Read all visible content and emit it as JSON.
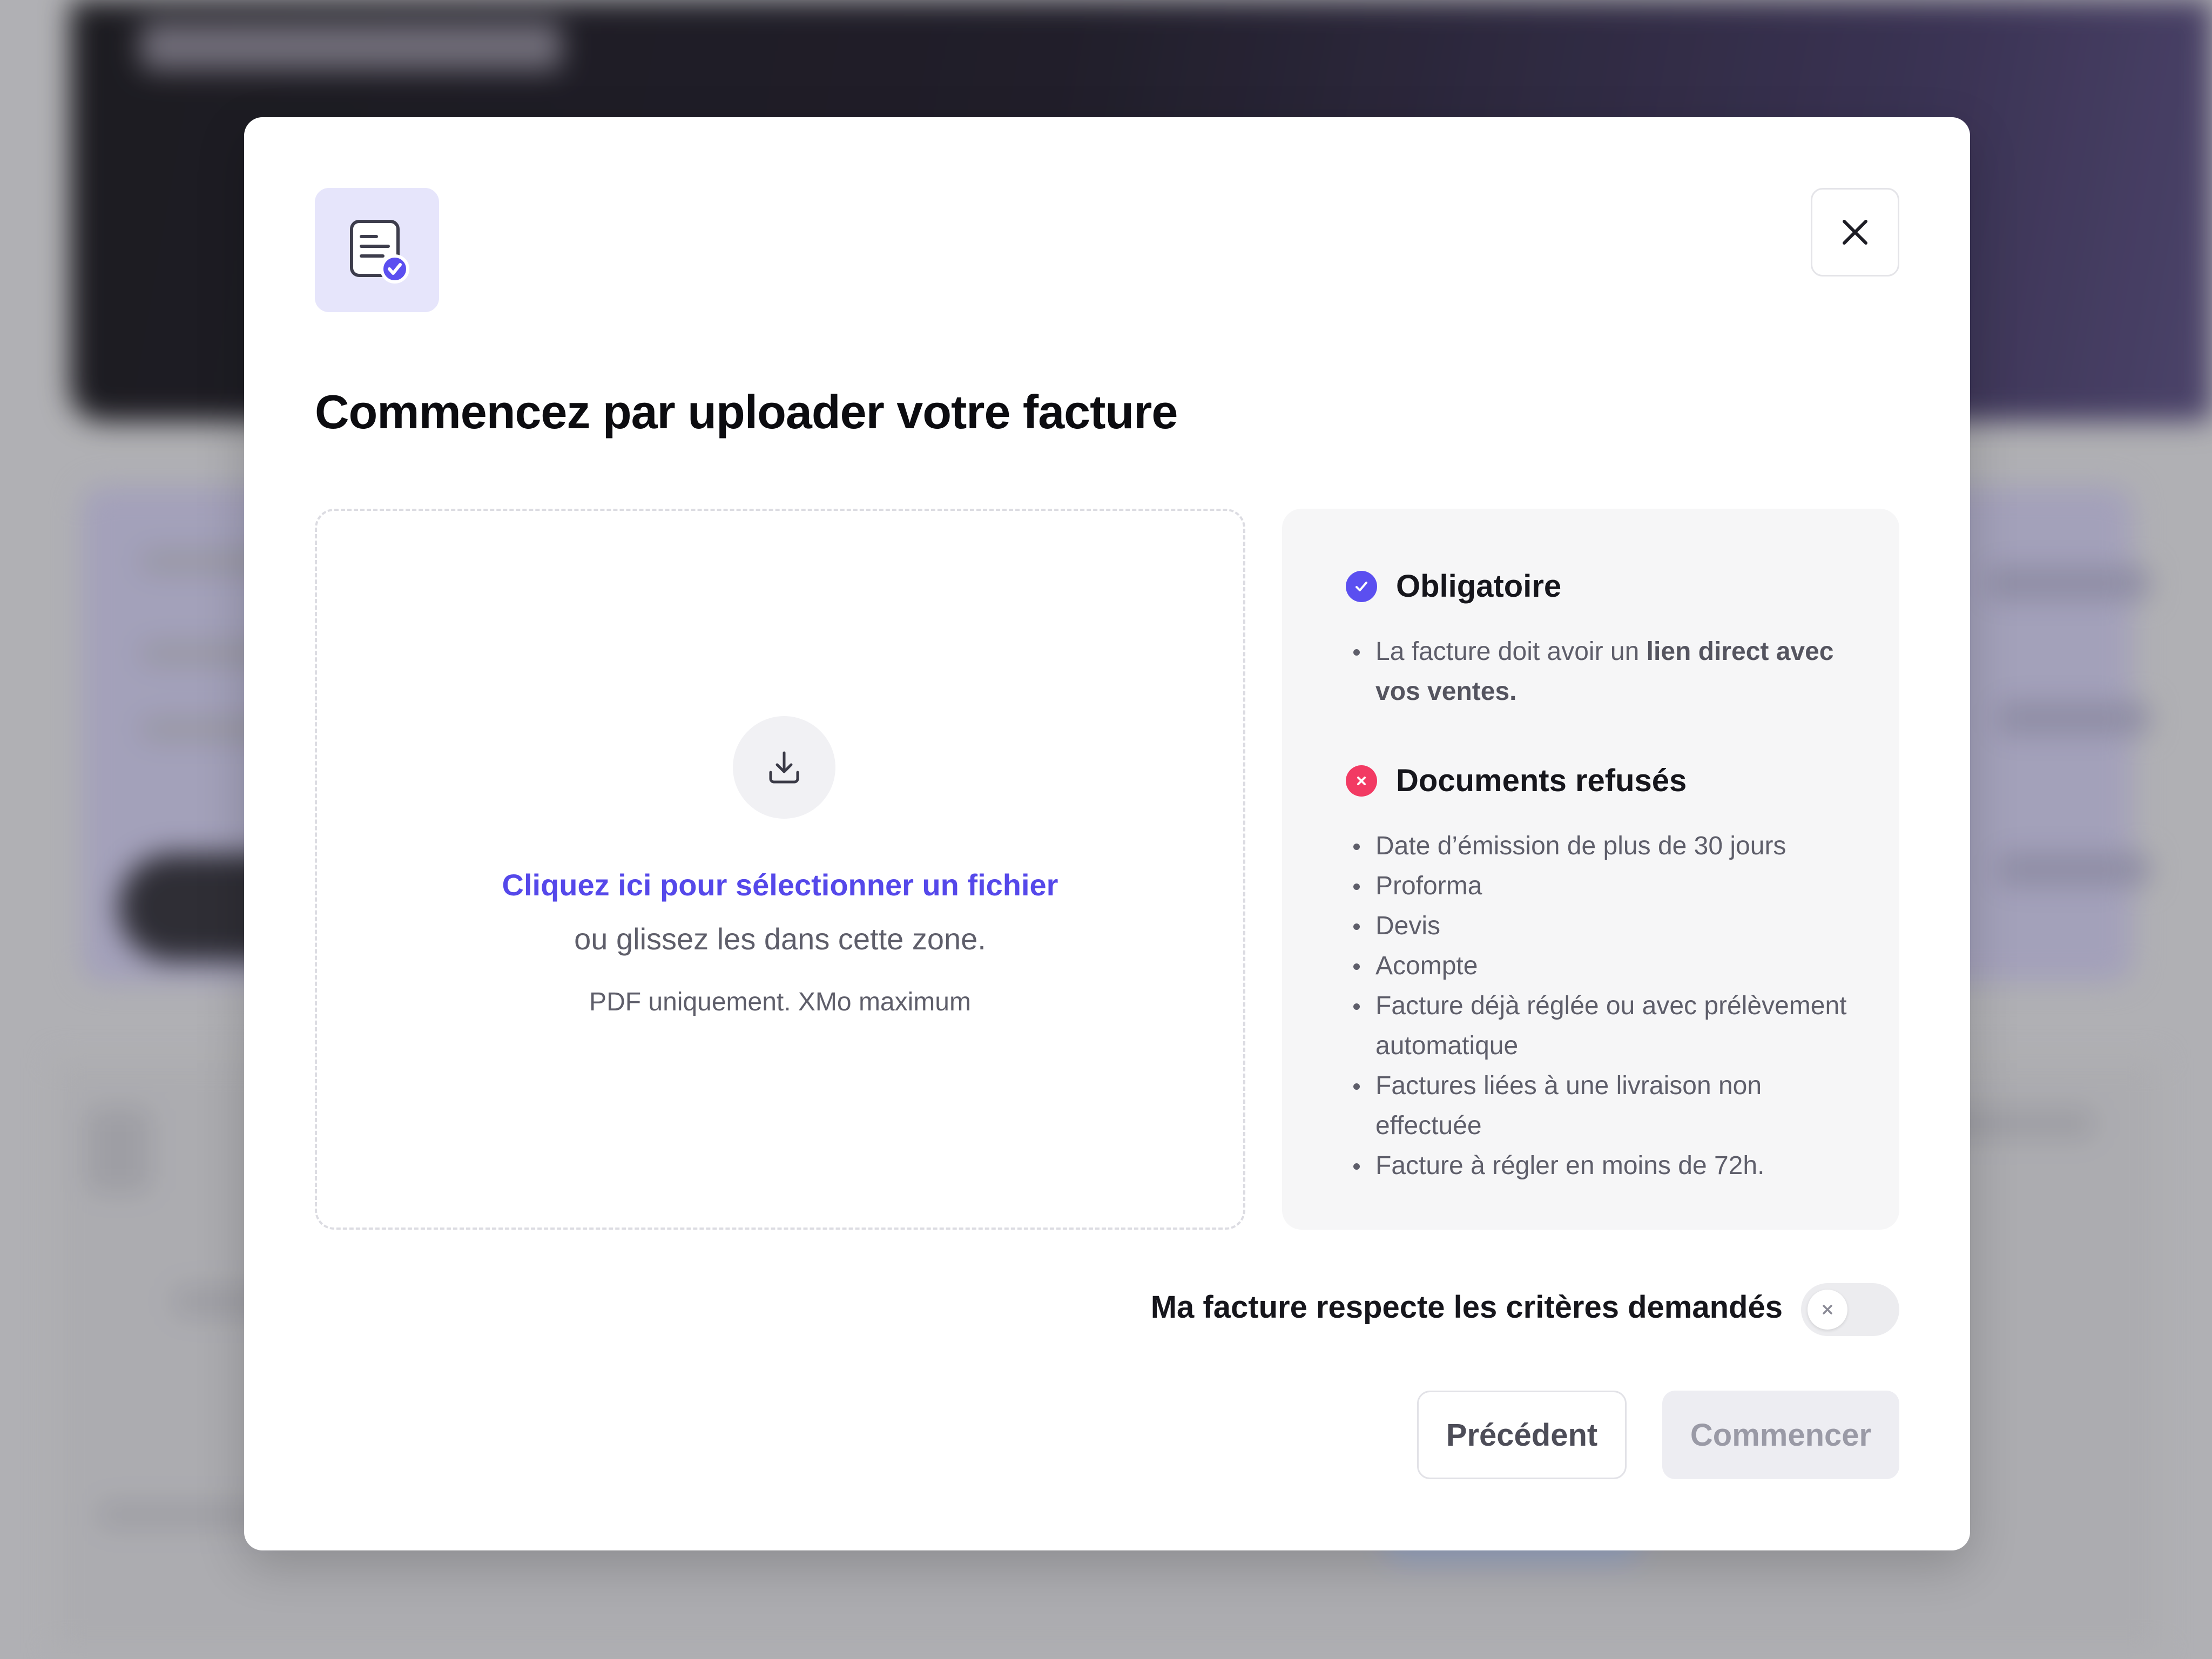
{
  "modal": {
    "title": "Commencez par uploader votre facture",
    "close_label": "Fermer"
  },
  "dropzone": {
    "link_text": "Cliquez ici pour sélectionner un fichier",
    "sub_text": "ou glissez les dans cette zone.",
    "hint_text": "PDF uniquement. XMo maximum"
  },
  "criteria": {
    "required": {
      "title": "Obligatoire",
      "item_prefix": "La facture doit avoir un ",
      "item_bold": "lien direct avec vos ventes."
    },
    "refused": {
      "title": "Documents refusés",
      "items": [
        "Date d’émission de plus de 30 jours",
        "Proforma",
        "Devis",
        "Acompte",
        "Facture déjà réglée ou avec prélèvement automatique",
        "Factures liées à une livraison non effectuée",
        "Facture à régler en moins de 72h."
      ]
    }
  },
  "toggle": {
    "label": "Ma facture respecte les critères demandés",
    "checked": false
  },
  "footer": {
    "prev_label": "Précédent",
    "start_label": "Commencer",
    "start_disabled": true
  },
  "colors": {
    "accent": "#5548ea",
    "error": "#f23a63",
    "icon_tile": "#e6e5fb"
  }
}
